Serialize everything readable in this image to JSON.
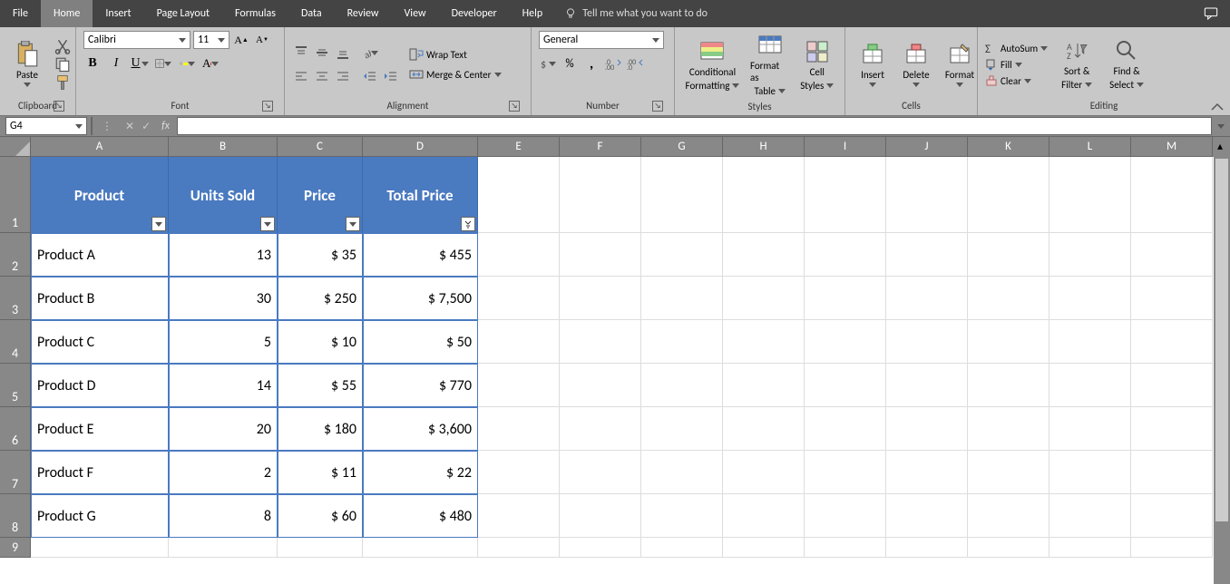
{
  "menu": {
    "tabs": [
      "File",
      "Home",
      "Insert",
      "Page Layout",
      "Formulas",
      "Data",
      "Review",
      "View",
      "Developer",
      "Help"
    ],
    "active": "Home",
    "tell_me": "Tell me what you want to do"
  },
  "ribbon": {
    "clipboard": {
      "label": "Clipboard",
      "paste": "Paste"
    },
    "font": {
      "label": "Font",
      "name": "Calibri",
      "size": "11"
    },
    "alignment": {
      "label": "Alignment",
      "wrap": "Wrap Text",
      "merge": "Merge & Center"
    },
    "number": {
      "label": "Number",
      "format": "General"
    },
    "styles": {
      "label": "Styles",
      "cond": "Conditional",
      "cond2": "Formatting",
      "fat": "Format as",
      "fat2": "Table",
      "cell": "Cell",
      "cell2": "Styles"
    },
    "cells": {
      "label": "Cells",
      "insert": "Insert",
      "delete": "Delete",
      "format": "Format"
    },
    "editing": {
      "label": "Editing",
      "autosum": "AutoSum",
      "fill": "Fill",
      "clear": "Clear",
      "sort": "Sort &",
      "sort2": "Filter",
      "find": "Find &",
      "find2": "Select"
    }
  },
  "namebox": "G4",
  "spreadsheet": {
    "col_widths": {
      "A": 152,
      "B": 120,
      "C": 94,
      "D": 127,
      "other": 90
    },
    "cols": [
      "A",
      "B",
      "C",
      "D",
      "E",
      "F",
      "G",
      "H",
      "I",
      "J",
      "K",
      "L",
      "M"
    ],
    "row1_h": 84,
    "data_row_h": 48,
    "headers": [
      "Product",
      "Units Sold",
      "Price",
      "Total Price"
    ],
    "rows": [
      {
        "product": "Product A",
        "units": "13",
        "price": "$ 35",
        "total": "$ 455"
      },
      {
        "product": "Product B",
        "units": "30",
        "price": "$ 250",
        "total": "$ 7,500"
      },
      {
        "product": "Product C",
        "units": "5",
        "price": "$ 10",
        "total": "$ 50"
      },
      {
        "product": "Product D",
        "units": "14",
        "price": "$ 55",
        "total": "$ 770"
      },
      {
        "product": "Product E",
        "units": "20",
        "price": "$ 180",
        "total": "$ 3,600"
      },
      {
        "product": "Product F",
        "units": "2",
        "price": "$ 11",
        "total": "$ 22"
      },
      {
        "product": "Product G",
        "units": "8",
        "price": "$ 60",
        "total": "$ 480"
      }
    ]
  },
  "glyphs": {
    "percent": "%",
    "comma": ","
  }
}
